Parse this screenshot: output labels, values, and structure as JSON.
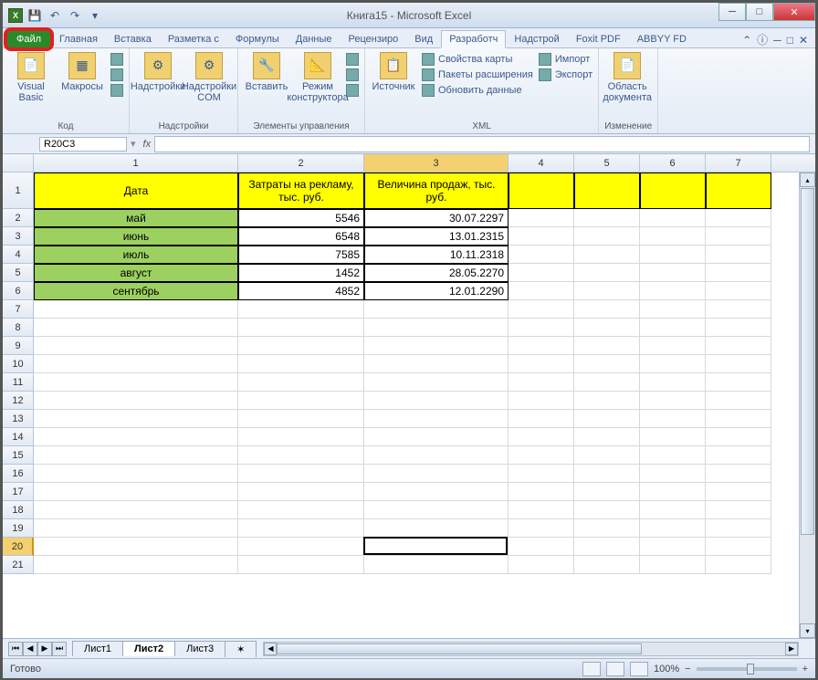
{
  "window": {
    "title": "Книга15 - Microsoft Excel"
  },
  "tabs": {
    "file": "Файл",
    "items": [
      "Главная",
      "Вставка",
      "Разметка с",
      "Формулы",
      "Данные",
      "Рецензиро",
      "Вид",
      "Разработч",
      "Надстрой",
      "Foxit PDF",
      "ABBYY FD"
    ],
    "active_index": 7
  },
  "ribbon": {
    "groups": [
      {
        "label": "Код",
        "big": [
          "Visual Basic",
          "Макросы"
        ]
      },
      {
        "label": "Надстройки",
        "big": [
          "Надстройки",
          "Надстройки COM"
        ]
      },
      {
        "label": "Элементы управления",
        "big": [
          "Вставить",
          "Режим конструктора"
        ]
      },
      {
        "label": "XML",
        "big": [
          "Источник"
        ],
        "small": [
          "Свойства карты",
          "Пакеты расширения",
          "Обновить данные",
          "Импорт",
          "Экспорт"
        ]
      },
      {
        "label": "Изменение",
        "big": [
          "Область документа"
        ]
      }
    ]
  },
  "formula": {
    "namebox": "R20C3",
    "fx": "fx",
    "value": ""
  },
  "grid": {
    "col_headers": [
      "1",
      "2",
      "3",
      "4",
      "5",
      "6",
      "7"
    ],
    "header_row": [
      "Дата",
      "Затраты на рекламу, тыс. руб.",
      "Величина продаж, тыс. руб."
    ],
    "data": [
      [
        "май",
        "5546",
        "30.07.2297"
      ],
      [
        "июнь",
        "6548",
        "13.01.2315"
      ],
      [
        "июль",
        "7585",
        "10.11.2318"
      ],
      [
        "август",
        "1452",
        "28.05.2270"
      ],
      [
        "сентябрь",
        "4852",
        "12.01.2290"
      ]
    ],
    "selected_row": 20
  },
  "sheets": {
    "items": [
      "Лист1",
      "Лист2",
      "Лист3"
    ],
    "active": 1
  },
  "status": {
    "ready": "Готово",
    "zoom": "100%"
  }
}
